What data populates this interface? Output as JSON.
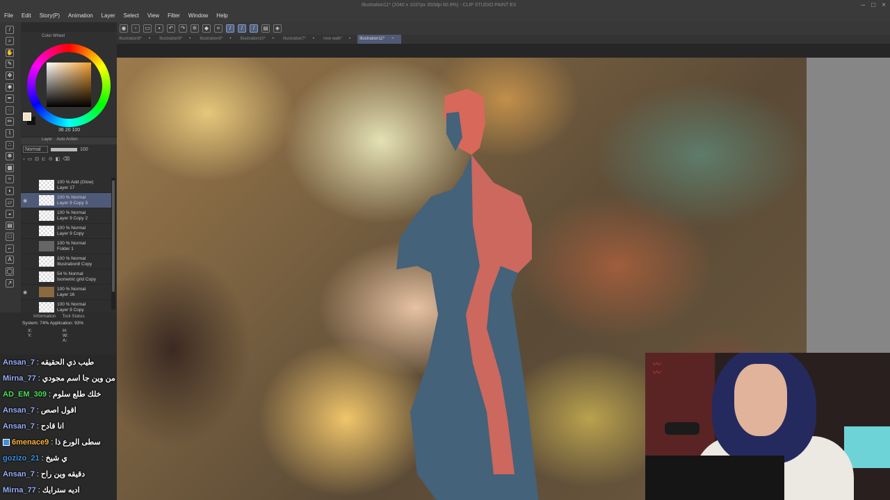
{
  "app": {
    "title": "Illustration11* (2040 x 1037px 350dpi 60.9%) - CLIP STUDIO PAINT EX"
  },
  "menu": [
    "File",
    "Edit",
    "Story(P)",
    "Animation",
    "Layer",
    "Select",
    "View",
    "Filter",
    "Window",
    "Help"
  ],
  "tabs": [
    {
      "label": "Illustration8*",
      "active": false
    },
    {
      "label": "Illustration9*",
      "active": false
    },
    {
      "label": "Illustration9*",
      "active": false
    },
    {
      "label": "Illustration10*",
      "active": false
    },
    {
      "label": "Illustration7*",
      "active": false
    },
    {
      "label": "new walk*",
      "active": false
    },
    {
      "label": "Illustration11*",
      "active": true
    }
  ],
  "color_panel": {
    "title": "Color Wheel",
    "h": "36",
    "s": "20",
    "v": "100"
  },
  "layer_panel": {
    "tab_layer": "Layer",
    "tab_auto": "Auto Action",
    "blend_mode": "Normal",
    "opacity": "100",
    "layers": [
      {
        "line1": "100 % Add (Glow)",
        "line2": "Layer 17",
        "selected": false,
        "visible": false
      },
      {
        "line1": "100 % Normal",
        "line2": "Layer 9 Copy 3",
        "selected": true,
        "visible": true
      },
      {
        "line1": "100 % Normal",
        "line2": "Layer 9 Copy 2",
        "selected": false,
        "visible": false
      },
      {
        "line1": "100 % Normal",
        "line2": "Layer 9 Copy",
        "selected": false,
        "visible": false
      },
      {
        "line1": "100 % Normal",
        "line2": "Folder 1",
        "selected": false,
        "visible": false
      },
      {
        "line1": "100 % Normal",
        "line2": "Illustration8 Copy",
        "selected": false,
        "visible": false
      },
      {
        "line1": "54 % Normal",
        "line2": "Isometric grid Copy",
        "selected": false,
        "visible": false
      },
      {
        "line1": "100 % Normal",
        "line2": "Layer 16",
        "selected": false,
        "visible": true
      },
      {
        "line1": "100 % Normal",
        "line2": "Layer 9 Copy",
        "selected": false,
        "visible": false
      }
    ]
  },
  "info_panel": {
    "title": "Information",
    "tab2": "Tool Status",
    "system": "System: 74%  Application: 93%",
    "x": "X:",
    "y": "Y:",
    "h": "H:",
    "w": "W:",
    "a": "A:"
  },
  "chat": [
    {
      "user": "Ansan_7",
      "msg": "طيب ذي الحقيقه",
      "color": "#9bb0ff",
      "badge": false
    },
    {
      "user": "Mirna_77",
      "msg": "من وين جا اسم مجودي",
      "color": "#9bb0ff",
      "badge": false
    },
    {
      "user": "AD_EM_309",
      "msg": "خلك طلع سلوم",
      "color": "#4be05b",
      "badge": false
    },
    {
      "user": "Ansan_7",
      "msg": "اقول اصص",
      "color": "#9bb0ff",
      "badge": false
    },
    {
      "user": "Ansan_7",
      "msg": "انا قادح",
      "color": "#9bb0ff",
      "badge": false
    },
    {
      "user": "6menace9",
      "msg": "سطى الورع ذا",
      "color": "#ffb23a",
      "badge": true
    },
    {
      "user": "gozizo_21",
      "msg": "ي شيخ",
      "color": "#3a8fe0",
      "badge": false
    },
    {
      "user": "Ansan_7",
      "msg": "دقيقه وين راح",
      "color": "#9bb0ff",
      "badge": false
    },
    {
      "user": "Mirna_77",
      "msg": "اديه سترايك",
      "color": "#9bb0ff",
      "badge": false
    }
  ],
  "colors": {
    "accent": "#51607a",
    "selected_layer": "#4f5a78",
    "figure_red": "#d8685a",
    "figure_blue": "#44627a"
  }
}
